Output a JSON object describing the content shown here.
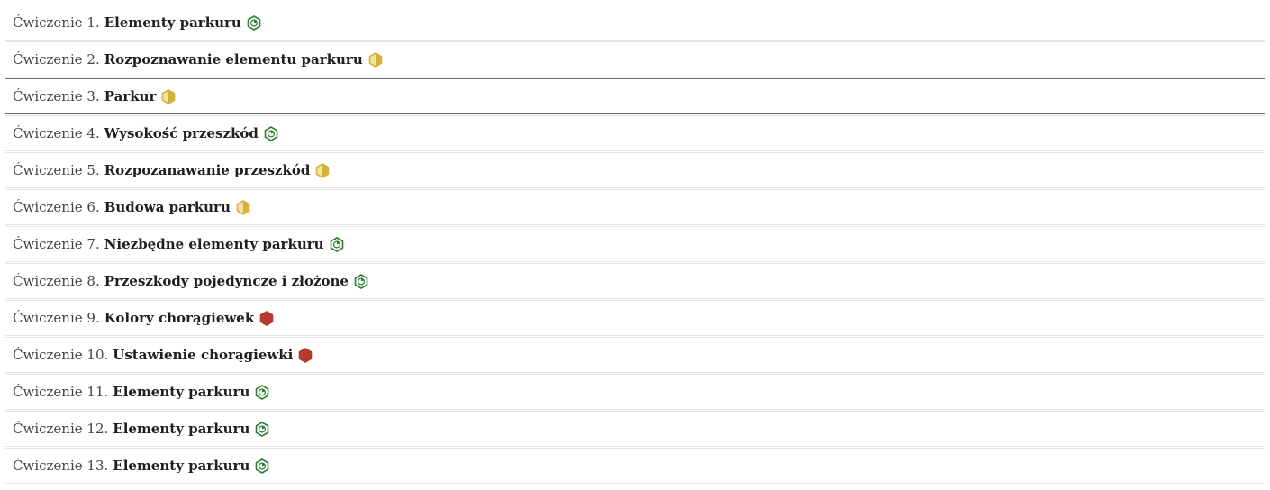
{
  "exercises": [
    {
      "prefix": "Ćwiczenie 1.",
      "title": "Elementy parkuru",
      "status": "started",
      "status_icon": "hexagon-progress-green-icon"
    },
    {
      "prefix": "Ćwiczenie 2.",
      "title": "Rozpoznawanie elementu parkuru",
      "status": "half",
      "status_icon": "hexagon-half-yellow-icon"
    },
    {
      "prefix": "Ćwiczenie 3.",
      "title": "Parkur",
      "status": "half",
      "status_icon": "hexagon-half-yellow-icon"
    },
    {
      "prefix": "Ćwiczenie 4.",
      "title": "Wysokość przeszkód",
      "status": "started",
      "status_icon": "hexagon-progress-green-icon"
    },
    {
      "prefix": "Ćwiczenie 5.",
      "title": "Rozpozanawanie przeszkód",
      "status": "half",
      "status_icon": "hexagon-half-yellow-icon"
    },
    {
      "prefix": "Ćwiczenie 6.",
      "title": "Budowa parkuru",
      "status": "half",
      "status_icon": "hexagon-half-yellow-icon"
    },
    {
      "prefix": "Ćwiczenie 7.",
      "title": "Niezbędne elementy parkuru",
      "status": "started",
      "status_icon": "hexagon-progress-green-icon"
    },
    {
      "prefix": "Ćwiczenie 8.",
      "title": "Przeszkody pojedyncze i złożone",
      "status": "started",
      "status_icon": "hexagon-progress-green-icon"
    },
    {
      "prefix": "Ćwiczenie 9.",
      "title": "Kolory chorągiewek",
      "status": "failed",
      "status_icon": "hexagon-filled-red-icon"
    },
    {
      "prefix": "Ćwiczenie 10.",
      "title": "Ustawienie chorągiewki",
      "status": "failed",
      "status_icon": "hexagon-filled-red-icon"
    },
    {
      "prefix": "Ćwiczenie 11.",
      "title": "Elementy parkuru",
      "status": "started",
      "status_icon": "hexagon-progress-green-icon"
    },
    {
      "prefix": "Ćwiczenie 12.",
      "title": "Elementy parkuru",
      "status": "started",
      "status_icon": "hexagon-progress-green-icon"
    },
    {
      "prefix": "Ćwiczenie 13.",
      "title": "Elementy parkuru",
      "status": "started",
      "status_icon": "hexagon-progress-green-icon"
    }
  ],
  "focused_index": 2,
  "colors": {
    "green": "#2e7d32",
    "yellow": "#d4b13a",
    "red": "#c0392b",
    "red_stroke": "#a33a33"
  }
}
